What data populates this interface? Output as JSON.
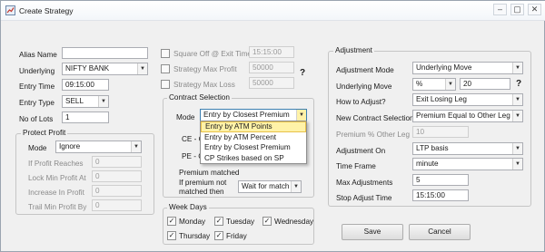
{
  "window": {
    "title": "Create Strategy"
  },
  "left": {
    "alias_label": "Alias Name",
    "alias_value": "",
    "underlying_label": "Underlying",
    "underlying_value": "NIFTY BANK",
    "entry_time_label": "Entry Time",
    "entry_time_value": "09:15:00",
    "entry_type_label": "Entry Type",
    "entry_type_value": "SELL",
    "lots_label": "No of Lots",
    "lots_value": "1"
  },
  "protect": {
    "title": "Protect Profit",
    "mode_label": "Mode",
    "mode_value": "Ignore",
    "if_profit_label": "If Profit Reaches",
    "if_profit_value": "0",
    "lock_label": "Lock Min Profit At",
    "lock_value": "0",
    "increase_label": "Increase In Profit",
    "increase_value": "0",
    "trail_label": "Trail Min Profit By",
    "trail_value": "0"
  },
  "middle": {
    "square_off_label": "Square Off @ Exit Time",
    "square_off_value": "15:15:00",
    "max_profit_label": "Strategy Max Profit",
    "max_profit_value": "50000",
    "max_loss_label": "Strategy Max Loss",
    "max_loss_value": "50000",
    "help": "?"
  },
  "contract": {
    "title": "Contract Selection",
    "mode_label": "Mode",
    "mode_value": "Entry by Closest Premium",
    "ce_label": "CE - C",
    "pe_label": "PE - C",
    "premium_label": "Premium matched",
    "not_matched_label_1": "If premium not",
    "not_matched_label_2": "matched then",
    "not_matched_value": "Wait for match",
    "options": [
      "Entry by ATM Points",
      "Entry by ATM Percent",
      "Entry by Closest Premium",
      "CP Strikes based on SP"
    ],
    "highlighted": "Entry by ATM Points"
  },
  "weekdays": {
    "title": "Week Days",
    "days": [
      {
        "label": "Monday",
        "checked": "✓"
      },
      {
        "label": "Tuesday",
        "checked": "✓"
      },
      {
        "label": "Wednesday",
        "checked": "✓"
      },
      {
        "label": "Thursday",
        "checked": "✓"
      },
      {
        "label": "Friday",
        "checked": "✓"
      }
    ]
  },
  "adjustment": {
    "title": "Adjustment",
    "mode_label": "Adjustment Mode",
    "mode_value": "Underlying Move",
    "move_label": "Underlying Move",
    "move_unit": "%",
    "move_value": "20",
    "how_label": "How to Adjust?",
    "how_value": "Exit Losing Leg",
    "new_contract_label": "New Contract Selection",
    "new_contract_value": "Premium Equal to Other Leg",
    "premium_other_label": "Premium % Other Leg",
    "premium_other_value": "10",
    "on_label": "Adjustment On",
    "on_value": "LTP basis",
    "timeframe_label": "Time Frame",
    "timeframe_value": "minute",
    "max_label": "Max Adjustments",
    "max_value": "5",
    "stop_label": "Stop Adjust Time",
    "stop_value": "15:15:00",
    "help": "?"
  },
  "buttons": {
    "save": "Save",
    "cancel": "Cancel"
  },
  "colors": {
    "dropdown_highlight": "#fff2a8",
    "accent": "#e8c24a"
  }
}
